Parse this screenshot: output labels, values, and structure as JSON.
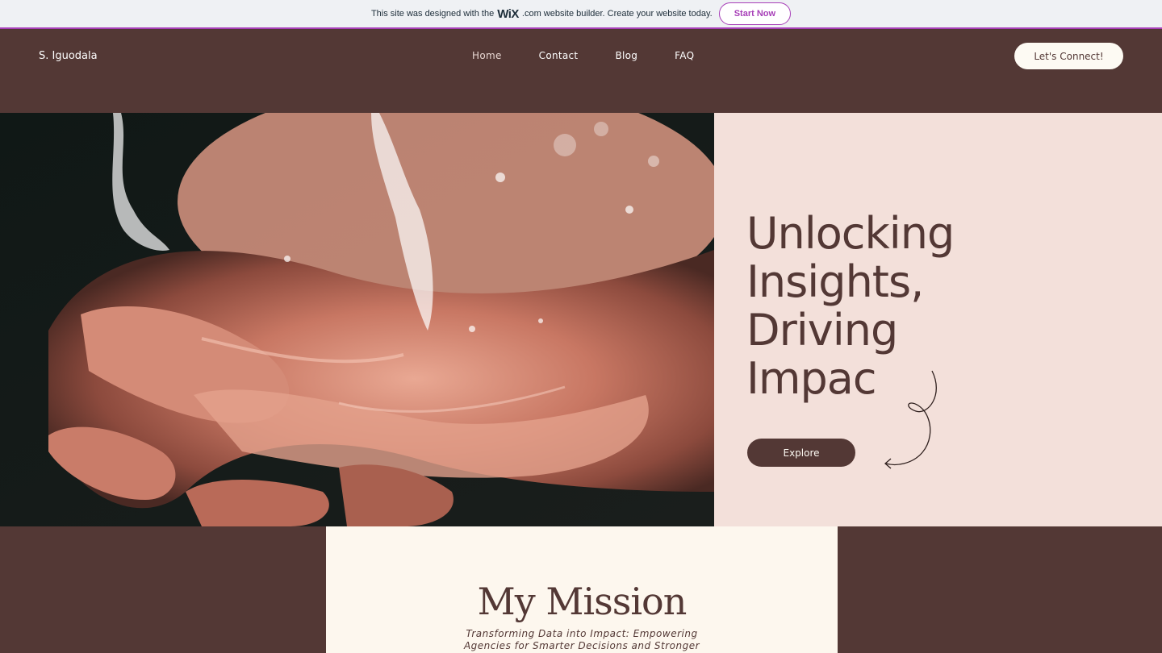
{
  "wix_banner": {
    "text_before": "This site was designed with the",
    "logo": "WiX",
    "text_after": ".com website builder. Create your website today.",
    "cta": "Start Now"
  },
  "header": {
    "brand": "S. Iguodala",
    "nav": [
      "Home",
      "Contact",
      "Blog",
      "FAQ"
    ],
    "active_nav": "Home",
    "cta": "Let's Connect!"
  },
  "hero": {
    "title": "Unlocking Insights, Driving Impac",
    "button": "Explore",
    "image_description": "water-splashing-on-hands-photo"
  },
  "mission": {
    "title": "My Mission",
    "subtitle": "Transforming Data into Impact: Empowering Agencies for Smarter Decisions and Stronger"
  },
  "colors": {
    "brown": "#533835",
    "blush": "#f3e0da",
    "cream": "#fdf7ee",
    "wix_purple": "#a73fb8"
  }
}
